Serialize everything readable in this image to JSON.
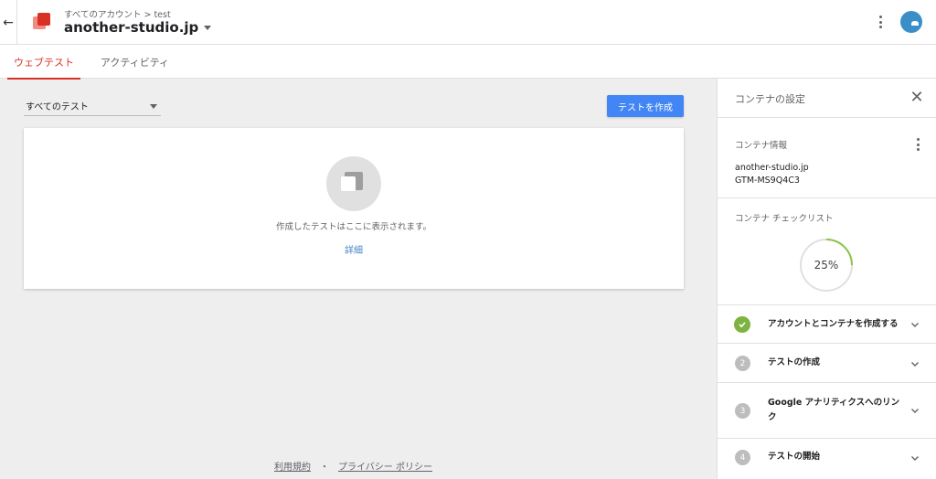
{
  "header": {
    "breadcrumb_root": "すべてのアカウント",
    "breadcrumb_sep": ">",
    "breadcrumb_account": "test",
    "container_name": "another-studio.jp"
  },
  "tabs": [
    {
      "label": "ウェブテスト",
      "active": true
    },
    {
      "label": "アクティビティ",
      "active": false
    }
  ],
  "main": {
    "filter_value": "すべてのテスト",
    "create_button": "テストを作成",
    "empty_message": "作成したテストはここに表示されます。",
    "details_link": "詳細"
  },
  "footer": {
    "terms": "利用規約",
    "dot": "・",
    "privacy": "プライバシー ポリシー"
  },
  "panel": {
    "title": "コンテナの設定",
    "info_label": "コンテナ情報",
    "domain": "another-studio.jp",
    "container_id": "GTM-MS9Q4C3",
    "checklist_label": "コンテナ チェックリスト",
    "progress_text": "25%",
    "progress_fraction": 0.25,
    "steps": [
      {
        "number": "1",
        "label": "アカウントとコンテナを作成する",
        "done": true
      },
      {
        "number": "2",
        "label": "テストの作成",
        "done": false
      },
      {
        "number": "3",
        "label": "Google アナリティクスへのリンク",
        "done": false
      },
      {
        "number": "4",
        "label": "テストの開始",
        "done": false
      }
    ]
  },
  "colors": {
    "accent_red": "#d93025",
    "primary_blue": "#4285f4",
    "done_green": "#7cb342",
    "progress_green": "#8bc34a"
  }
}
